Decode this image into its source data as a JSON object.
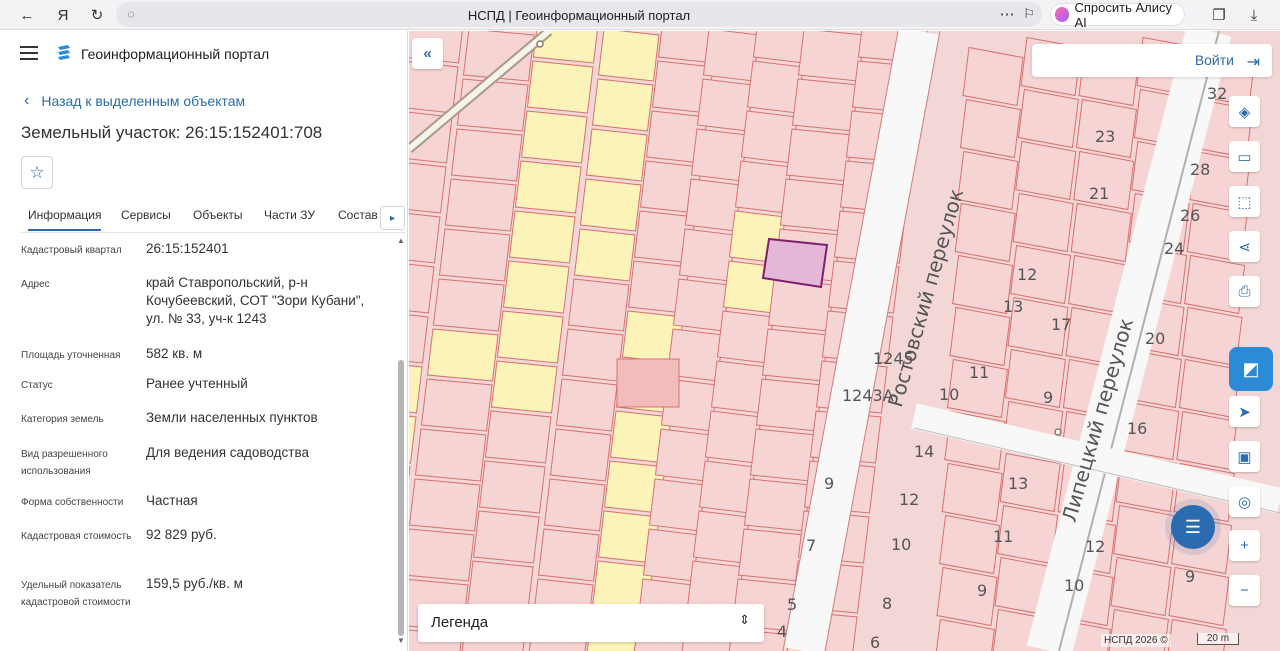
{
  "browser": {
    "tab_title": "НСПД | Геоинформационный портал",
    "alice_label": "Спросить Алису AI",
    "icons": [
      "back-icon",
      "yandex-icon",
      "reload-icon",
      "shield-icon",
      "more-icon",
      "bookmark-icon",
      "collections-icon",
      "download-icon"
    ]
  },
  "sidebar": {
    "portal_title": "Геоинформационный портал",
    "back_link": "Назад к выделенным объектам",
    "parcel_title": "Земельный участок: 26:15:152401:708",
    "tabs": [
      "Информация",
      "Сервисы",
      "Объекты",
      "Части ЗУ",
      "Состав"
    ],
    "active_tab": "Информация",
    "info": [
      {
        "label": "Кадастровый квартал",
        "value": "26:15:152401"
      },
      {
        "label": "Адрес",
        "value": "край Ставропольский, р-н Кочубеевский, СОТ \"Зори Кубани\", ул. № 33, уч-к 1243"
      },
      {
        "label": "Площадь уточненная",
        "value": "582 кв. м"
      },
      {
        "label": "Статус",
        "value": "Ранее учтенный"
      },
      {
        "label": "Категория земель",
        "value": "Земли населенных пунктов"
      },
      {
        "label": "Вид разрешенного использования",
        "value": "Для ведения садоводства"
      },
      {
        "label": "Форма собственности",
        "value": "Частная"
      },
      {
        "label": "Кадастровая стоимость",
        "value": "92 829 руб."
      },
      {
        "label": "Удельный показатель кадастровой стоимости",
        "value": "159,5 руб./кв. м"
      }
    ]
  },
  "map": {
    "login_label": "Войти",
    "legend_label": "Легенда",
    "attribution": "НСПД 2026 ©",
    "scale": "20 m",
    "street_labels": [
      "Ростовский переулок",
      "Липецкий переулок"
    ],
    "parcel_numbers": [
      "23",
      "32",
      "28",
      "21",
      "26",
      "24",
      "12",
      "13",
      "17",
      "1245",
      "1243А",
      "10",
      "11",
      "9",
      "20",
      "16",
      "14",
      "13",
      "9",
      "12",
      "10",
      "11",
      "12",
      "7",
      "5",
      "8",
      "9",
      "10",
      "9",
      "4",
      "6"
    ],
    "colors": {
      "parcel_fill": "#f7d4d4",
      "parcel_border": "#d87070",
      "garden_fill": "#fbf3b8",
      "selected_fill": "#e4b6d8",
      "selected_border": "#7d1f6e",
      "accent": "#2b6cb0"
    }
  }
}
